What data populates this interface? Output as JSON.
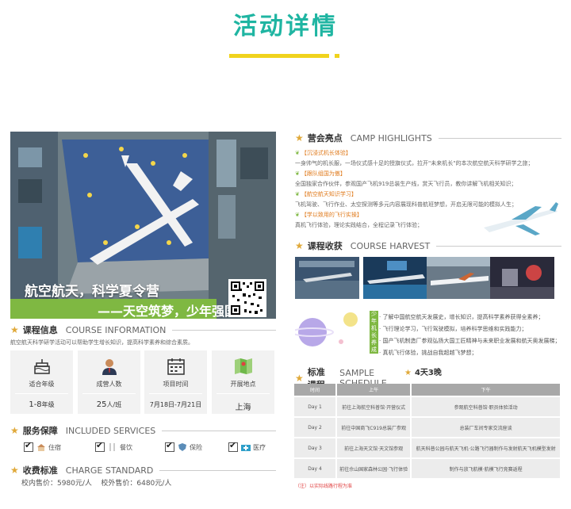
{
  "page_title": "活动详情",
  "hero": {
    "main_text": "航空航天，科学夏令营",
    "sub_text": "——天空筑梦，少年强国"
  },
  "course_info": {
    "title_cn": "课程信息",
    "title_en": "COURSE INFORMATION",
    "description": "航空航天科学研学活动可以帮助学生增长知识，提高科学素养和综合素质。",
    "items": [
      {
        "label": "适合年级",
        "value": "1-8",
        "unit": "年级"
      },
      {
        "label": "成营人数",
        "value": "25",
        "unit": "人/班"
      },
      {
        "label": "项目时间",
        "value": "7月18日-7月21日",
        "unit": ""
      },
      {
        "label": "开展地点",
        "value": "上海",
        "unit": ""
      }
    ]
  },
  "services": {
    "title_cn": "服务保障",
    "title_en": "INCLUDED SERVICES",
    "items": [
      "住宿",
      "餐饮",
      "保险",
      "医疗"
    ]
  },
  "charge": {
    "title_cn": "收费标准",
    "title_en": "CHARGE STANDARD",
    "text": "校内售价：5980元/人    校外售价：6480元/人"
  },
  "highlights": {
    "title_cn": "营会亮点",
    "title_en": "CAMP HIGHLIGHTS",
    "items": [
      {
        "title": "【沉浸式机长体验】",
        "desc": "一身帅气的机长服，一场仪式感十足的授旗仪式，拉开\"未来机长\"的本次航空航天科学研学之旅；"
      },
      {
        "title": "【跟队组国为傲】",
        "desc": "全国独家合作伙伴，参观国产飞机919总装生产线，赏天飞行员，教你讲解飞机相关知识；"
      },
      {
        "title": "【航空航天知识学习】",
        "desc": "飞机驾驶、飞行作业、太空探测等多元内容展现科普航班梦想，开启无限可能的模拟人生；"
      },
      {
        "title": "【学以致用的飞行实操】",
        "desc": "真机飞行体验，理论实践结合，全程记录飞行体验；"
      }
    ]
  },
  "harvest": {
    "title_cn": "课程收获",
    "title_en": "COURSE HARVEST",
    "tag": "少年机长养成记",
    "items": [
      "· 了解中国航空航天发展史，增长知识，提高科学素养获得全素养；",
      "· 飞行理论学习，飞行驾驶模拟，培养科学思维和实践能力；",
      "· 国产飞机制造厂参观弘扬大国工匠精神与未来职业发展和航天奥发展梯；",
      "· 真机飞行体验，挑战自我超越飞梦想；"
    ]
  },
  "schedule": {
    "title_cn": "标准课程",
    "title_en": "SAMPLE SCHEDULE",
    "days_label": "4天3晚",
    "headers": [
      "时间",
      "上午",
      "下午"
    ],
    "rows": [
      [
        "Day 1",
        "前往上海航空科普馆·开营仪式",
        "参观航空科普馆·职员体验活动"
      ],
      [
        "Day 2",
        "前往中国商飞C919总装厂参观",
        "总装厂车间专家交流座谈"
      ],
      [
        "Day 3",
        "前往上海天文馆·天文馆参观",
        "航天科普公园与航天飞机·公路飞行器制作与发射航天飞机模型发射"
      ],
      [
        "Day 4",
        "前往佘山国家森林公园·飞行体验",
        "制作与放飞航模·航模飞行竞赛返程"
      ]
    ],
    "note": "（注）以实际线路行程为准"
  },
  "colors": {
    "teal": "#1fb5a2",
    "yellow": "#f0d31d",
    "green": "#7fb842",
    "orange": "#e07b1d"
  }
}
